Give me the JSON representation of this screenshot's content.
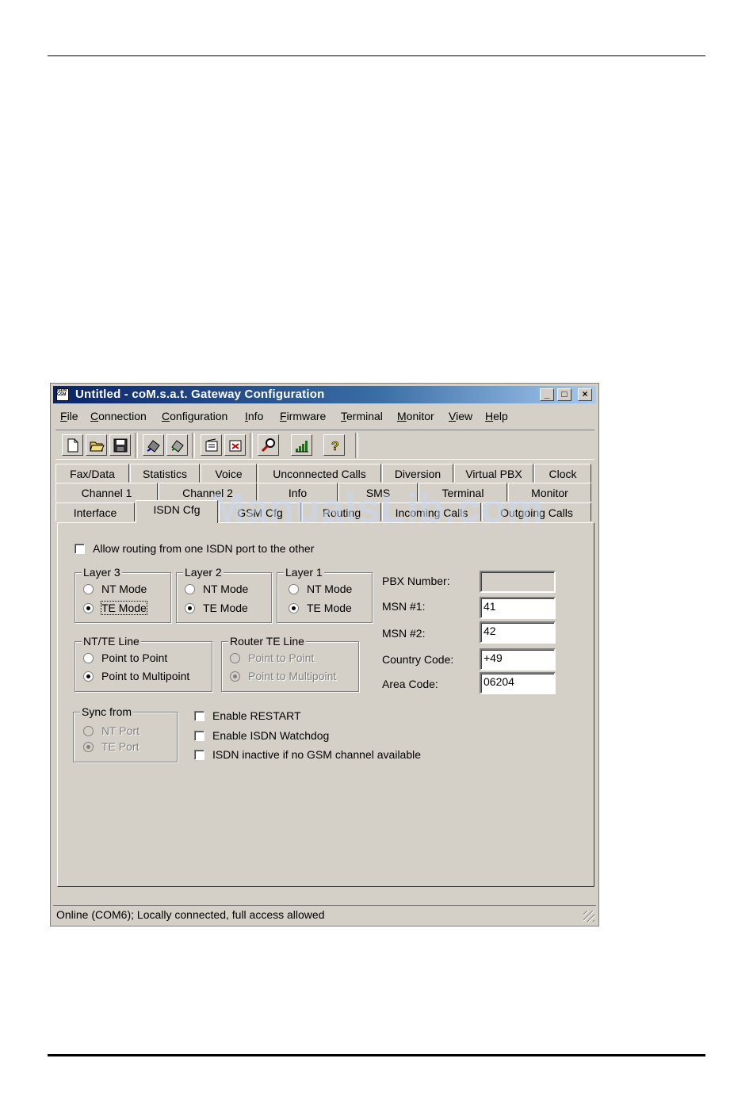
{
  "window": {
    "title": "Untitled - coM.s.a.t. Gateway Configuration",
    "app_icon_text": "ISDN GSM"
  },
  "menu": [
    {
      "accel": "F",
      "rest": "ile"
    },
    {
      "accel": "C",
      "rest": "onnection"
    },
    {
      "accel": "C",
      "rest": "onfiguration"
    },
    {
      "accel": "I",
      "rest": "nfo"
    },
    {
      "accel": "F",
      "rest": "irmware",
      "prefix": ""
    },
    {
      "accel": "T",
      "rest": "erminal"
    },
    {
      "accel": "M",
      "rest": "onitor"
    },
    {
      "accel": "V",
      "rest": "iew"
    },
    {
      "accel": "H",
      "rest": "elp"
    }
  ],
  "toolbar": {
    "icons": [
      "new-file-icon",
      "open-folder-icon",
      "save-icon",
      "connect-icon",
      "disconnect-icon",
      "read-config-icon",
      "write-config-icon",
      "search-icon",
      "signal-icon",
      "help-icon"
    ]
  },
  "tabs": {
    "row1": [
      "Fax/Data",
      "Statistics",
      "Voice",
      "Unconnected Calls",
      "Diversion",
      "Virtual PBX",
      "Clock"
    ],
    "row2": [
      "Channel 1",
      "Channel 2",
      "Info",
      "SMS",
      "Terminal",
      "Monitor"
    ],
    "row3": [
      "Interface",
      "ISDN Cfg",
      "GSM Cfg",
      "Routing",
      "Incoming Calls",
      "Outgoing Calls"
    ],
    "active": "ISDN Cfg"
  },
  "routing_checkbox": {
    "label": "Allow routing from one ISDN port to the other",
    "checked": false
  },
  "layer3": {
    "title": "Layer 3",
    "nt": "NT Mode",
    "te": "TE Mode",
    "selected": "TE Mode"
  },
  "layer2": {
    "title": "Layer 2",
    "nt": "NT Mode",
    "te": "TE Mode",
    "selected": "TE Mode"
  },
  "layer1": {
    "title": "Layer 1",
    "nt": "NT Mode",
    "te": "TE Mode",
    "selected": "TE Mode"
  },
  "ntte_line": {
    "title": "NT/TE Line",
    "p2p": "Point to Point",
    "p2mp": "Point to Multipoint",
    "selected": "Point to Multipoint"
  },
  "router_te_line": {
    "title": "Router TE Line",
    "p2p": "Point to Point",
    "p2mp": "Point to Multipoint",
    "selected": "Point to Multipoint",
    "disabled": true
  },
  "sync_from": {
    "title": "Sync from",
    "nt": "NT Port",
    "te": "TE Port",
    "selected": "TE Port",
    "disabled": true
  },
  "options": [
    {
      "label": "Enable RESTART",
      "checked": false
    },
    {
      "label": "Enable ISDN Watchdog",
      "checked": false
    },
    {
      "label": "ISDN inactive if no GSM channel available",
      "checked": false
    }
  ],
  "fields": {
    "pbx_number": {
      "label": "PBX Number:",
      "value": ""
    },
    "msn1": {
      "label": "MSN #1:",
      "value": "41"
    },
    "msn2": {
      "label": "MSN #2:",
      "value": "42"
    },
    "country_code": {
      "label": "Country Code:",
      "value": "+49"
    },
    "area_code": {
      "label": "Area Code:",
      "value": "06204"
    }
  },
  "status": "Online (COM6); Locally connected, full access allowed",
  "watermark": "ManualsLib.com"
}
